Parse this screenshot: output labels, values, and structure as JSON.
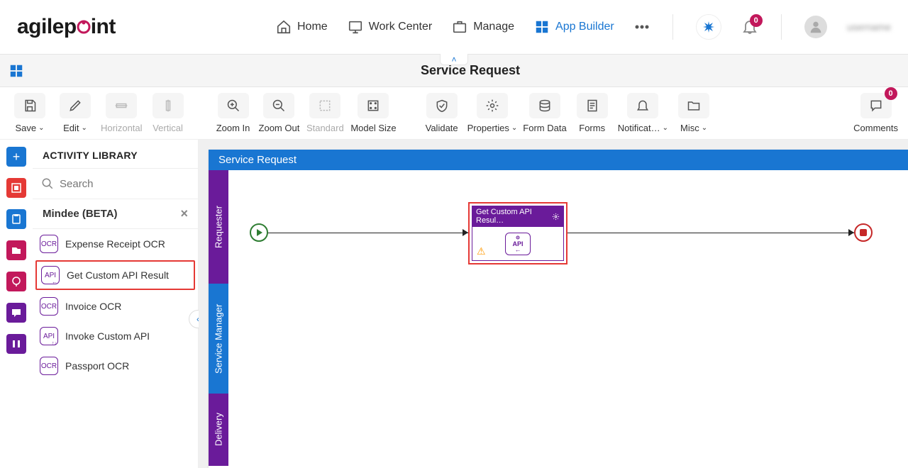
{
  "nav": {
    "home": "Home",
    "work_center": "Work Center",
    "manage": "Manage",
    "app_builder": "App Builder",
    "notif_count": "0",
    "username": "username"
  },
  "subheader": {
    "title": "Service Request"
  },
  "toolbar": {
    "save": "Save",
    "edit": "Edit",
    "horizontal": "Horizontal",
    "vertical": "Vertical",
    "zoom_in": "Zoom In",
    "zoom_out": "Zoom Out",
    "standard": "Standard",
    "model_size": "Model Size",
    "validate": "Validate",
    "properties": "Properties",
    "form_data": "Form Data",
    "forms": "Forms",
    "notifications": "Notificat…",
    "misc": "Misc",
    "comments": "Comments",
    "comments_count": "0"
  },
  "library": {
    "title": "ACTIVITY LIBRARY",
    "search_placeholder": "Search",
    "category": "Mindee (BETA)",
    "items": [
      "Expense Receipt OCR",
      "Get Custom API Result",
      "Invoice OCR",
      "Invoke Custom API",
      "Passport OCR"
    ]
  },
  "canvas": {
    "title": "Service Request",
    "lanes": [
      "Requester",
      "Service Manager",
      "Delivery"
    ],
    "activity_label": "Get Custom API Resul…",
    "activity_icon_text": "API"
  }
}
